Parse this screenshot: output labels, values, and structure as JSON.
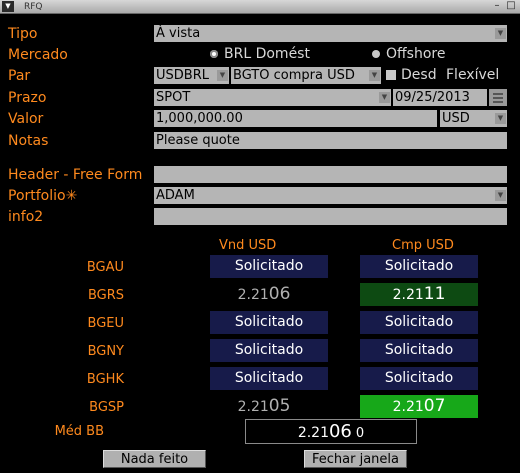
{
  "window": {
    "title": "RFQ"
  },
  "form": {
    "tipo": {
      "label": "Tipo",
      "value": "À vista"
    },
    "mercado": {
      "label": "Mercado",
      "options": [
        "BRL Domést",
        "Offshore"
      ],
      "selected": "BRL Domést"
    },
    "par": {
      "label": "Par",
      "pair": "USDBRL",
      "rate": "BGTO compra USD",
      "desd_label": "Desd",
      "flexivel_label": "Flexível"
    },
    "prazo": {
      "label": "Prazo",
      "value": "SPOT",
      "date": "09/25/2013"
    },
    "valor": {
      "label": "Valor",
      "amount": "1,000,000.00",
      "currency": "USD"
    },
    "notas": {
      "label": "Notas",
      "value": "Please quote"
    },
    "header_free_form": {
      "label": "Header - Free Form",
      "value": ""
    },
    "portfolio": {
      "label": "Portfolio✳",
      "value": "ADAM"
    },
    "info2": {
      "label": "info2",
      "value": ""
    }
  },
  "quotes": {
    "sell_header": "Vnd USD",
    "buy_header": "Cmp USD",
    "rows": [
      {
        "bank": "BGAU",
        "sell": "Solicitado",
        "buy": "Solicitado"
      },
      {
        "bank": "BGRS",
        "sell_main": "2.21",
        "sell_pips": "06",
        "buy_main": "2.21",
        "buy_pips": "11"
      },
      {
        "bank": "BGEU",
        "sell": "Solicitado",
        "buy": "Solicitado"
      },
      {
        "bank": "BGNY",
        "sell": "Solicitado",
        "buy": "Solicitado"
      },
      {
        "bank": "BGHK",
        "sell": "Solicitado",
        "buy": "Solicitado"
      },
      {
        "bank": "BGSP",
        "sell_main": "2.21",
        "sell_pips": "05",
        "buy_main": "2.21",
        "buy_pips": "07"
      }
    ],
    "mid": {
      "label": "Méd BB",
      "main": "2.21",
      "pips": "06",
      "extra": "0"
    }
  },
  "buttons": {
    "nada_feito": "Nada feito",
    "fechar_janela": "Fechar janela"
  },
  "colors": {
    "label": "#ff8a1e",
    "quote_button": "#171b4a",
    "best_buy_dark": "#0d4a12",
    "best_buy_bright": "#17a819"
  }
}
